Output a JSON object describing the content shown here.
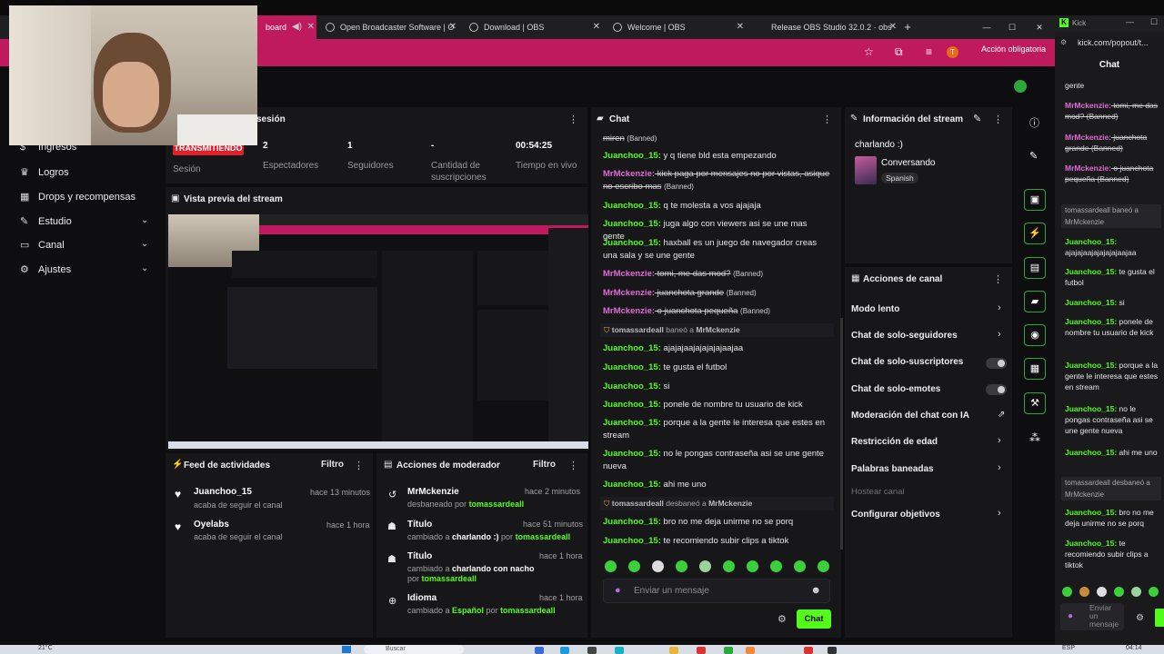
{
  "browser": {
    "tabs": [
      {
        "label": "board"
      },
      {
        "label": "Open Broadcaster Software | O"
      },
      {
        "label": "Download | OBS"
      },
      {
        "label": "Welcome | OBS"
      },
      {
        "label": "Release OBS Studio 32.0.2 · obs"
      }
    ],
    "new_tab": "+",
    "window_min": "—",
    "window_max": "☐",
    "window_close": "✕",
    "accion_label": "Acción obligatoria",
    "profile_initial": "T"
  },
  "sidebar": {
    "items": [
      {
        "label": "Ingresos"
      },
      {
        "label": "Logros"
      },
      {
        "label": "Drops y recompensas"
      },
      {
        "label": "Estudio"
      },
      {
        "label": "Canal"
      },
      {
        "label": "Ajustes"
      }
    ]
  },
  "session": {
    "title": "sesión",
    "live_badge": "TRANSMITIENDO",
    "stats": [
      {
        "value": "",
        "label": "Sesión"
      },
      {
        "value": "2",
        "label": "Espectadores"
      },
      {
        "value": "1",
        "label": "Seguidores"
      },
      {
        "value": "-",
        "label": "Cantidad de suscripciones"
      },
      {
        "value": "00:54:25",
        "label": "Tiempo en vivo"
      }
    ]
  },
  "preview": {
    "title": "Vista previa del stream"
  },
  "feed": {
    "title": "Feed de actividades",
    "filter": "Filtro",
    "items": [
      {
        "name": "Juanchoo_15",
        "sub": "acaba de seguir el canal",
        "time": "hace 13 minutos"
      },
      {
        "name": "Oyelabs",
        "sub": "acaba de seguir el canal",
        "time": "hace 1 hora"
      }
    ]
  },
  "mod": {
    "title": "Acciones de moderador",
    "filter": "Filtro",
    "items": [
      {
        "title": "MrMckenzie",
        "time": "hace 2 minutos",
        "pre": "desbaneado por ",
        "user": "tomassardeall"
      },
      {
        "title": "Título",
        "time": "hace 51 minutos",
        "pre": "cambiado a ",
        "val": "charlando :)",
        "mid": " por ",
        "user": "tomassardeall"
      },
      {
        "title": "Título",
        "time": "hace 1 hora",
        "pre": "cambiado a ",
        "val": "charlando con nacho",
        "mid": " por ",
        "user": "tomassardeall"
      },
      {
        "title": "Idioma",
        "time": "hace 1 hora",
        "pre": "cambiado a ",
        "val": "Español",
        "mid": " por ",
        "user": "tomassardeall"
      }
    ]
  },
  "chat": {
    "title": "Chat",
    "placeholder": "Enviar un mensaje",
    "send": "Chat",
    "banned_tag": "(Banned)",
    "lines": [
      {
        "user": "",
        "text": "miren",
        "banned": true,
        "mr": false
      },
      {
        "user": "Juanchoo_15:",
        "text": " y q tiene bld esta empezando",
        "banned": false,
        "mr": false
      },
      {
        "user": "MrMckenzie:",
        "text": " kick paga por mensajes no por vistas, asique no escribo mas",
        "banned": true,
        "mr": true
      },
      {
        "user": "Juanchoo_15:",
        "text": " q te molesta a vos ajajaja",
        "banned": false,
        "mr": false
      },
      {
        "user": "Juanchoo_15:",
        "text": " juga algo con viewers asi se une mas gente",
        "banned": false,
        "mr": false
      },
      {
        "user": "Juanchoo_15:",
        "text": " haxball es un juego de navegador creas una sala y se une gente",
        "banned": false,
        "mr": false
      },
      {
        "user": "MrMckenzie:",
        "text": " tomi, me das mod?",
        "banned": true,
        "mr": true
      },
      {
        "user": "MrMckenzie:",
        "text": " juanchota grande",
        "banned": true,
        "mr": true
      },
      {
        "user": "MrMckenzie:",
        "text": " o juanchota pequeña",
        "banned": true,
        "mr": true
      },
      {
        "user": "Juanchoo_15:",
        "text": " ajajajaajajajajajaajaa",
        "banned": false,
        "mr": false
      },
      {
        "user": "Juanchoo_15:",
        "text": " te gusta el futbol",
        "banned": false,
        "mr": false
      },
      {
        "user": "Juanchoo_15:",
        "text": " si",
        "banned": false,
        "mr": false
      },
      {
        "user": "Juanchoo_15:",
        "text": " ponele de nombre tu usuario de kick",
        "banned": false,
        "mr": false
      },
      {
        "user": "Juanchoo_15:",
        "text": " porque a la gente le interesa que estes en stream",
        "banned": false,
        "mr": false
      },
      {
        "user": "Juanchoo_15:",
        "text": " no le pongas contraseña asi se une gente nueva",
        "banned": false,
        "mr": false
      },
      {
        "user": "Juanchoo_15:",
        "text": " ahi me uno",
        "banned": false,
        "mr": false
      },
      {
        "user": "Juanchoo_15:",
        "text": " bro no me deja unirme no se porq",
        "banned": false,
        "mr": false
      },
      {
        "user": "Juanchoo_15:",
        "text": " te recomiendo subir clips a tiktok",
        "banned": false,
        "mr": false
      }
    ],
    "system": [
      {
        "actor": "tomassardeall",
        "verb": " baneó a ",
        "target": "MrMckenzie"
      },
      {
        "actor": "tomassardeall",
        "verb": " desbaneó a ",
        "target": "MrMckenzie"
      }
    ]
  },
  "info": {
    "title": "Información del stream",
    "stream_title": "charlando :)",
    "category": "Conversando",
    "language": "Spanish"
  },
  "actions": {
    "title": "Acciones de canal",
    "rows": [
      {
        "label": "Modo lento"
      },
      {
        "label": "Chat de solo-seguidores"
      },
      {
        "label": "Chat de solo-suscriptores"
      },
      {
        "label": "Chat de solo-emotes"
      },
      {
        "label": "Moderación del chat con IA"
      },
      {
        "label": "Restricción de edad"
      },
      {
        "label": "Palabras baneadas"
      },
      {
        "label": "Hostear canal"
      },
      {
        "label": "Configurar objetivos"
      }
    ],
    "toggles": {
      "subs_only": false,
      "emote_only": false
    }
  },
  "popout": {
    "tab_label": "Kick",
    "url": "kick.com/popout/t...",
    "title": "Chat",
    "lines": [
      {
        "user": "",
        "text": "gente"
      },
      {
        "user": "MrMckenzie:",
        "text": " tomi, me das mod? (Banned)"
      },
      {
        "user": "MrMckenzie:",
        "text": " juanchota grande (Banned)"
      },
      {
        "user": "MrMckenzie:",
        "text": " o juanchota pequeña (Banned)"
      },
      {
        "user": "Juanchoo_15:",
        "text": " ajajajaajajajajajaajaa"
      },
      {
        "user": "Juanchoo_15:",
        "text": " te gusta el futbol"
      },
      {
        "user": "Juanchoo_15:",
        "text": " si"
      },
      {
        "user": "Juanchoo_15:",
        "text": " ponele de nombre tu usuario de kick"
      },
      {
        "user": "Juanchoo_15:",
        "text": " porque a la gente le interesa que estes en stream"
      },
      {
        "user": "Juanchoo_15:",
        "text": " no le pongas contraseña asi se une gente nueva"
      },
      {
        "user": "Juanchoo_15:",
        "text": " ahi me uno"
      },
      {
        "user": "Juanchoo_15:",
        "text": " bro no me deja unirme no se porq"
      },
      {
        "user": "Juanchoo_15:",
        "text": " te recomiendo subir clips a tiktok"
      }
    ],
    "sys1": "tomassardeall baneó a MrMckenzie",
    "sys2": "tomassardeall desbaneó a MrMckenzie",
    "placeholder": "Enviar un mensaje"
  },
  "taskbar": {
    "temp": "21°C",
    "search": "Buscar",
    "lang": "ESP",
    "time": "04:14"
  },
  "colors": {
    "kick_green": "#53fc18",
    "tab_active": "#c01a5e",
    "live_red": "#e0202d"
  }
}
